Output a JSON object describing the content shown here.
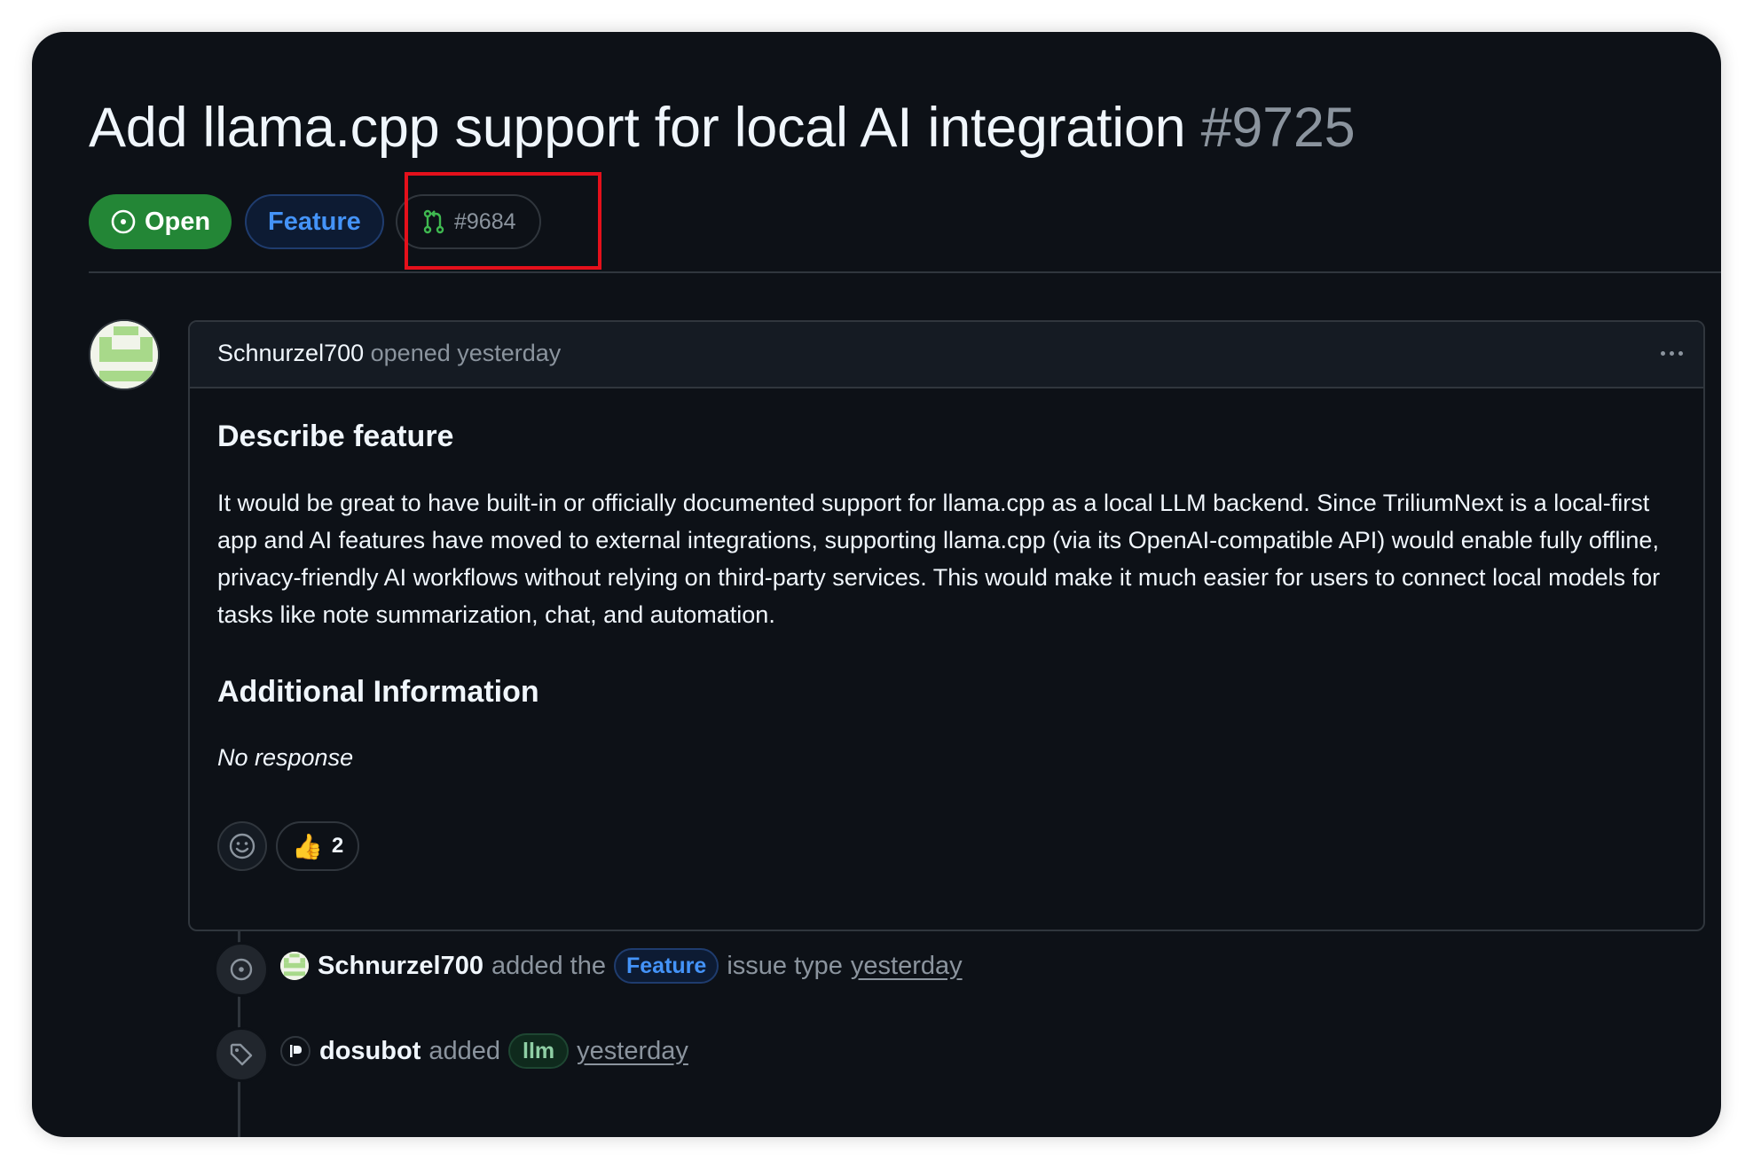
{
  "issue": {
    "title": "Add llama.cpp support for local AI integration",
    "number": "#9725",
    "status": "Open",
    "type_label": "Feature",
    "linked_pr": "#9684"
  },
  "comment": {
    "author": "Schnurzel700",
    "meta": "opened yesterday",
    "heading_describe": "Describe feature",
    "body": "It would be great to have built-in or officially documented support for llama.cpp as a local LLM backend. Since TriliumNext is a local-first app and AI features have moved to external integrations, supporting llama.cpp (via its OpenAI-compatible API) would enable fully offline, privacy-friendly AI workflows without relying on third-party services. This would make it much easier for users to connect local models for tasks like note summarization, chat, and automation.",
    "heading_additional": "Additional Information",
    "additional": "No response",
    "reactions": [
      {
        "emoji": "👍",
        "count": "2"
      }
    ]
  },
  "timeline": [
    {
      "icon": "issue-type-icon",
      "actor": "Schnurzel700",
      "text_before": "added the",
      "label": "Feature",
      "text_after": "issue type",
      "time": "yesterday"
    },
    {
      "icon": "tag-icon",
      "actor": "dosubot",
      "text_before": "added",
      "label": "llm",
      "time": "yesterday"
    }
  ],
  "colors": {
    "background": "#0d1117",
    "open_green": "#238636",
    "accent_blue": "#4493f8",
    "highlight_red": "#e4101b"
  }
}
